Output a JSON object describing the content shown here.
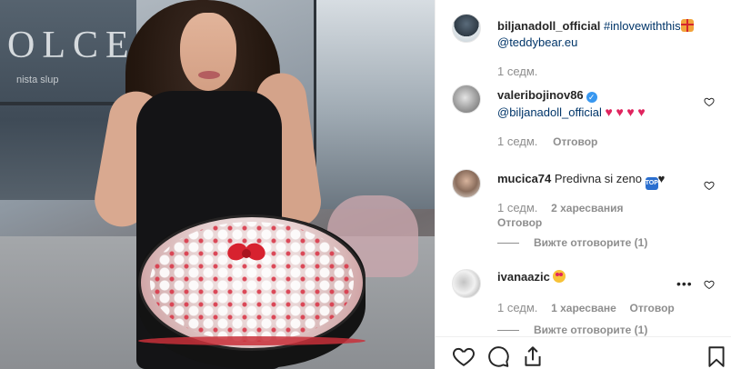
{
  "caption": {
    "username": "biljanadoll_official",
    "hashtag": "#inlovewiththis",
    "gift_emoji": "gift-emoji",
    "mention": "@teddybear.eu",
    "time": "1 седм."
  },
  "comments": [
    {
      "username": "valeribojinov86",
      "verified": true,
      "mention": "@biljanadoll_official",
      "emoji": "red-hearts-emoji",
      "time": "1 седм.",
      "reply_label": "Отговор"
    },
    {
      "username": "mucica74",
      "text": "Predivna si zeno",
      "emoji": "top-emoji",
      "time": "1 седм.",
      "likes_label": "2 харесвания",
      "reply_label": "Отговор",
      "view_replies": "Вижте отговорите (1)"
    },
    {
      "username": "ivanaazic",
      "emoji": "heart-eyes-emoji",
      "more": "•••",
      "time": "1 седм.",
      "likes_label": "1 харесване",
      "reply_label": "Отговор",
      "view_replies": "Вижте отговорите (1)"
    }
  ],
  "photo": {
    "store_sign": "OLCE",
    "store_sub": "nista slup"
  },
  "actions": {
    "like": "heart-icon",
    "comment": "comment-icon",
    "share": "share-icon",
    "save": "bookmark-icon"
  },
  "colors": {
    "link": "#003569",
    "meta": "#8e8e8e",
    "verified": "#3897f0",
    "heart": "#e0245e"
  }
}
